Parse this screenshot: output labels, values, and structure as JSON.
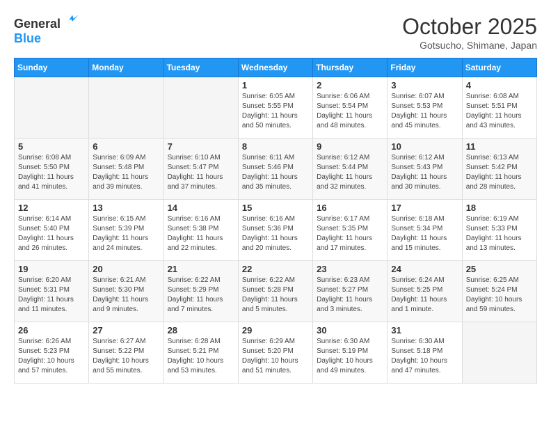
{
  "logo": {
    "line1": "General",
    "line2": "Blue"
  },
  "title": "October 2025",
  "subtitle": "Gotsucho, Shimane, Japan",
  "weekdays": [
    "Sunday",
    "Monday",
    "Tuesday",
    "Wednesday",
    "Thursday",
    "Friday",
    "Saturday"
  ],
  "weeks": [
    [
      {
        "day": "",
        "info": ""
      },
      {
        "day": "",
        "info": ""
      },
      {
        "day": "",
        "info": ""
      },
      {
        "day": "1",
        "info": "Sunrise: 6:05 AM\nSunset: 5:55 PM\nDaylight: 11 hours\nand 50 minutes."
      },
      {
        "day": "2",
        "info": "Sunrise: 6:06 AM\nSunset: 5:54 PM\nDaylight: 11 hours\nand 48 minutes."
      },
      {
        "day": "3",
        "info": "Sunrise: 6:07 AM\nSunset: 5:53 PM\nDaylight: 11 hours\nand 45 minutes."
      },
      {
        "day": "4",
        "info": "Sunrise: 6:08 AM\nSunset: 5:51 PM\nDaylight: 11 hours\nand 43 minutes."
      }
    ],
    [
      {
        "day": "5",
        "info": "Sunrise: 6:08 AM\nSunset: 5:50 PM\nDaylight: 11 hours\nand 41 minutes."
      },
      {
        "day": "6",
        "info": "Sunrise: 6:09 AM\nSunset: 5:48 PM\nDaylight: 11 hours\nand 39 minutes."
      },
      {
        "day": "7",
        "info": "Sunrise: 6:10 AM\nSunset: 5:47 PM\nDaylight: 11 hours\nand 37 minutes."
      },
      {
        "day": "8",
        "info": "Sunrise: 6:11 AM\nSunset: 5:46 PM\nDaylight: 11 hours\nand 35 minutes."
      },
      {
        "day": "9",
        "info": "Sunrise: 6:12 AM\nSunset: 5:44 PM\nDaylight: 11 hours\nand 32 minutes."
      },
      {
        "day": "10",
        "info": "Sunrise: 6:12 AM\nSunset: 5:43 PM\nDaylight: 11 hours\nand 30 minutes."
      },
      {
        "day": "11",
        "info": "Sunrise: 6:13 AM\nSunset: 5:42 PM\nDaylight: 11 hours\nand 28 minutes."
      }
    ],
    [
      {
        "day": "12",
        "info": "Sunrise: 6:14 AM\nSunset: 5:40 PM\nDaylight: 11 hours\nand 26 minutes."
      },
      {
        "day": "13",
        "info": "Sunrise: 6:15 AM\nSunset: 5:39 PM\nDaylight: 11 hours\nand 24 minutes."
      },
      {
        "day": "14",
        "info": "Sunrise: 6:16 AM\nSunset: 5:38 PM\nDaylight: 11 hours\nand 22 minutes."
      },
      {
        "day": "15",
        "info": "Sunrise: 6:16 AM\nSunset: 5:36 PM\nDaylight: 11 hours\nand 20 minutes."
      },
      {
        "day": "16",
        "info": "Sunrise: 6:17 AM\nSunset: 5:35 PM\nDaylight: 11 hours\nand 17 minutes."
      },
      {
        "day": "17",
        "info": "Sunrise: 6:18 AM\nSunset: 5:34 PM\nDaylight: 11 hours\nand 15 minutes."
      },
      {
        "day": "18",
        "info": "Sunrise: 6:19 AM\nSunset: 5:33 PM\nDaylight: 11 hours\nand 13 minutes."
      }
    ],
    [
      {
        "day": "19",
        "info": "Sunrise: 6:20 AM\nSunset: 5:31 PM\nDaylight: 11 hours\nand 11 minutes."
      },
      {
        "day": "20",
        "info": "Sunrise: 6:21 AM\nSunset: 5:30 PM\nDaylight: 11 hours\nand 9 minutes."
      },
      {
        "day": "21",
        "info": "Sunrise: 6:22 AM\nSunset: 5:29 PM\nDaylight: 11 hours\nand 7 minutes."
      },
      {
        "day": "22",
        "info": "Sunrise: 6:22 AM\nSunset: 5:28 PM\nDaylight: 11 hours\nand 5 minutes."
      },
      {
        "day": "23",
        "info": "Sunrise: 6:23 AM\nSunset: 5:27 PM\nDaylight: 11 hours\nand 3 minutes."
      },
      {
        "day": "24",
        "info": "Sunrise: 6:24 AM\nSunset: 5:25 PM\nDaylight: 11 hours\nand 1 minute."
      },
      {
        "day": "25",
        "info": "Sunrise: 6:25 AM\nSunset: 5:24 PM\nDaylight: 10 hours\nand 59 minutes."
      }
    ],
    [
      {
        "day": "26",
        "info": "Sunrise: 6:26 AM\nSunset: 5:23 PM\nDaylight: 10 hours\nand 57 minutes."
      },
      {
        "day": "27",
        "info": "Sunrise: 6:27 AM\nSunset: 5:22 PM\nDaylight: 10 hours\nand 55 minutes."
      },
      {
        "day": "28",
        "info": "Sunrise: 6:28 AM\nSunset: 5:21 PM\nDaylight: 10 hours\nand 53 minutes."
      },
      {
        "day": "29",
        "info": "Sunrise: 6:29 AM\nSunset: 5:20 PM\nDaylight: 10 hours\nand 51 minutes."
      },
      {
        "day": "30",
        "info": "Sunrise: 6:30 AM\nSunset: 5:19 PM\nDaylight: 10 hours\nand 49 minutes."
      },
      {
        "day": "31",
        "info": "Sunrise: 6:30 AM\nSunset: 5:18 PM\nDaylight: 10 hours\nand 47 minutes."
      },
      {
        "day": "",
        "info": ""
      }
    ]
  ]
}
